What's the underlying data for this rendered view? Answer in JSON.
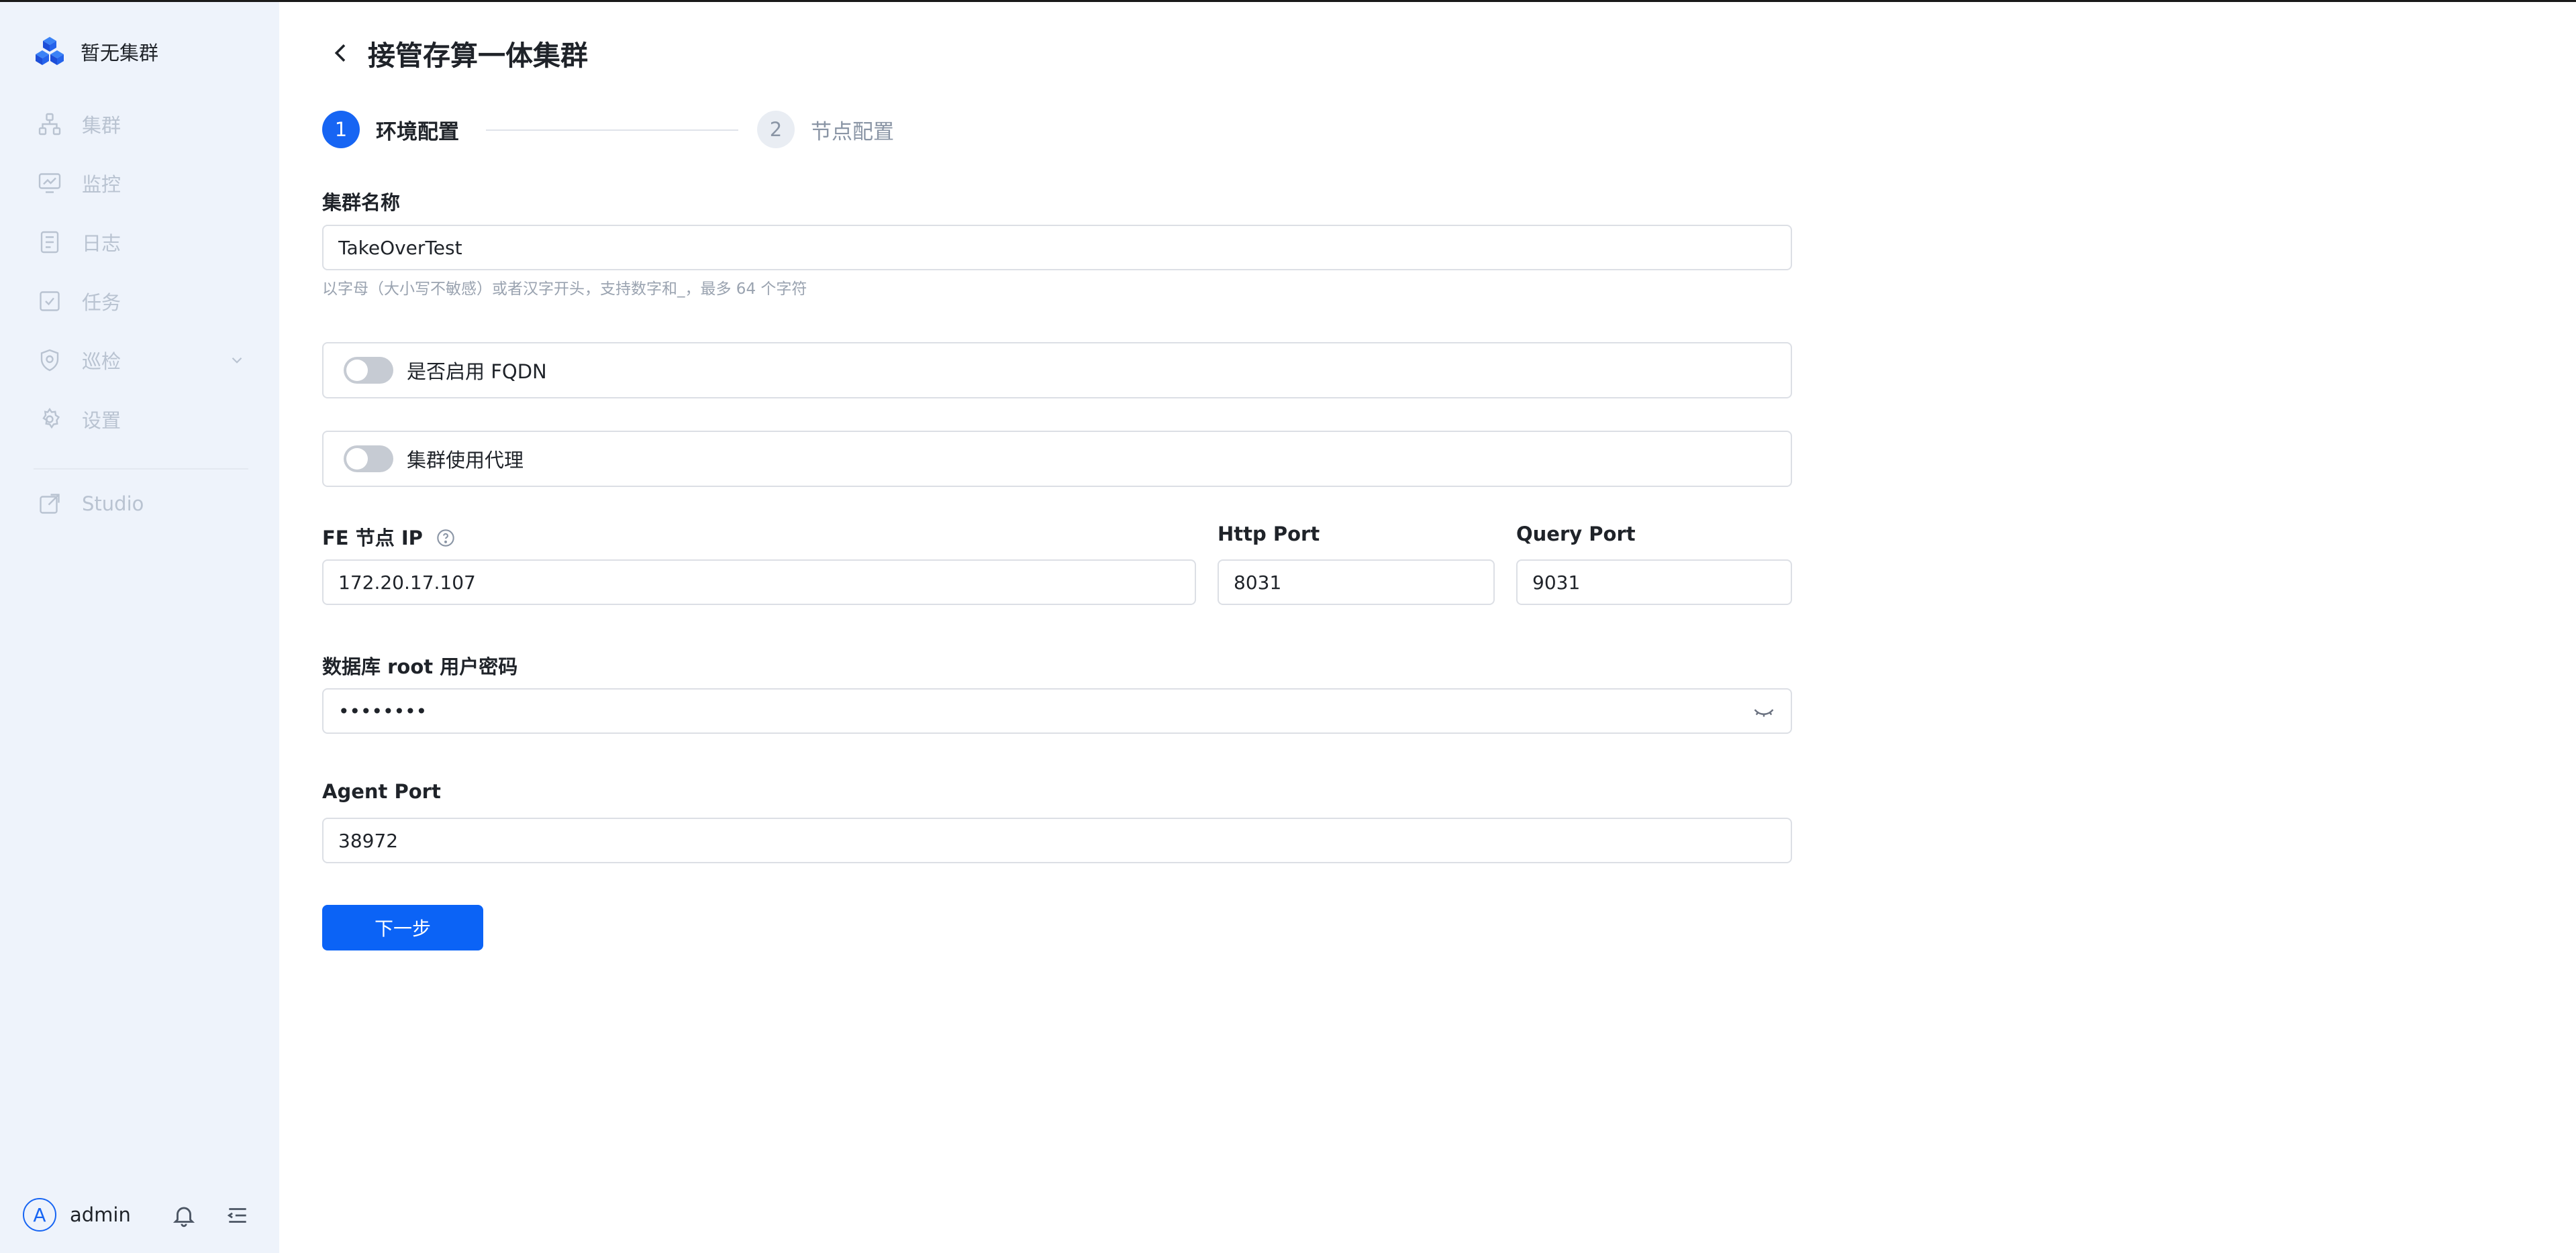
{
  "sidebar": {
    "brand": "暂无集群",
    "items": [
      {
        "label": "集群",
        "icon": "cluster-icon"
      },
      {
        "label": "监控",
        "icon": "monitor-icon"
      },
      {
        "label": "日志",
        "icon": "log-icon"
      },
      {
        "label": "任务",
        "icon": "task-icon"
      },
      {
        "label": "巡检",
        "icon": "inspection-icon"
      },
      {
        "label": "设置",
        "icon": "settings-icon"
      },
      {
        "label": "Studio",
        "icon": "external-link-icon"
      }
    ],
    "user": {
      "avatar_letter": "A",
      "name": "admin"
    }
  },
  "header": {
    "title": "接管存算一体集群"
  },
  "steps": [
    {
      "number": "1",
      "label": "环境配置",
      "active": true
    },
    {
      "number": "2",
      "label": "节点配置",
      "active": false
    }
  ],
  "form": {
    "cluster_name_label": "集群名称",
    "cluster_name_value": "TakeOverTest",
    "cluster_name_hint": "以字母（大小写不敏感）或者汉字开头，支持数字和_，最多 64 个字符",
    "fqdn_label": "是否启用 FQDN",
    "proxy_label": "集群使用代理",
    "fe_ip_label": "FE 节点 IP",
    "fe_ip_value": "172.20.17.107",
    "http_port_label": "Http Port",
    "http_port_value": "8031",
    "query_port_label": "Query Port",
    "query_port_value": "9031",
    "root_password_label": "数据库 root 用户密码",
    "root_password_value": "••••••••",
    "agent_port_label": "Agent Port",
    "agent_port_value": "38972",
    "next_button": "下一步"
  },
  "colors": {
    "primary": "#1765f3",
    "sidebar_bg": "#eef3fb"
  }
}
